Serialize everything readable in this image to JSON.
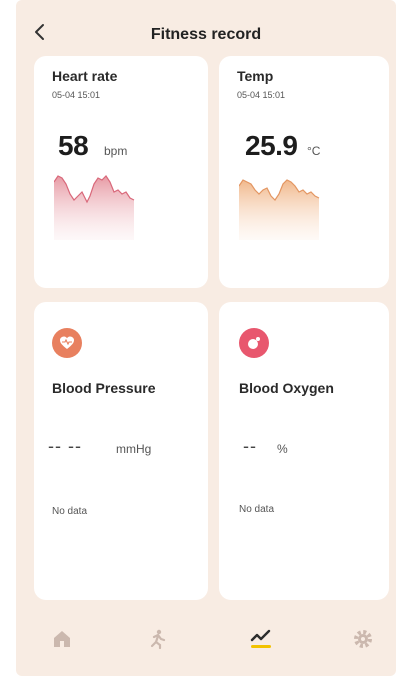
{
  "header": {
    "title": "Fitness record",
    "back_icon": "chevron-left-icon"
  },
  "cards": {
    "heart_rate": {
      "title": "Heart rate",
      "time": "05-04 15:01",
      "value": "58",
      "unit": "bpm",
      "color": "#e9a2ab"
    },
    "temp": {
      "title": "Temp",
      "time": "05-04 15:01",
      "value": "25.9",
      "unit": "°C",
      "color": "#f1c09a"
    },
    "blood_pressure": {
      "title": "Blood Pressure",
      "value": "-- --",
      "unit": "mmHg",
      "status": "No data",
      "icon": "blood-pressure-icon",
      "color": "#e8805f"
    },
    "blood_oxygen": {
      "title": "Blood Oxygen",
      "value": "--",
      "unit": "%",
      "status": "No data",
      "icon": "blood-oxygen-icon",
      "color": "#e8576e"
    }
  },
  "bottom_nav": {
    "items": [
      "home-icon",
      "activity-icon",
      "records-icon",
      "settings-icon"
    ],
    "active_index": 2,
    "active_color": "#2c2c2c",
    "active_underline": "#f2c200",
    "inactive_color": "#cbb8ae"
  }
}
